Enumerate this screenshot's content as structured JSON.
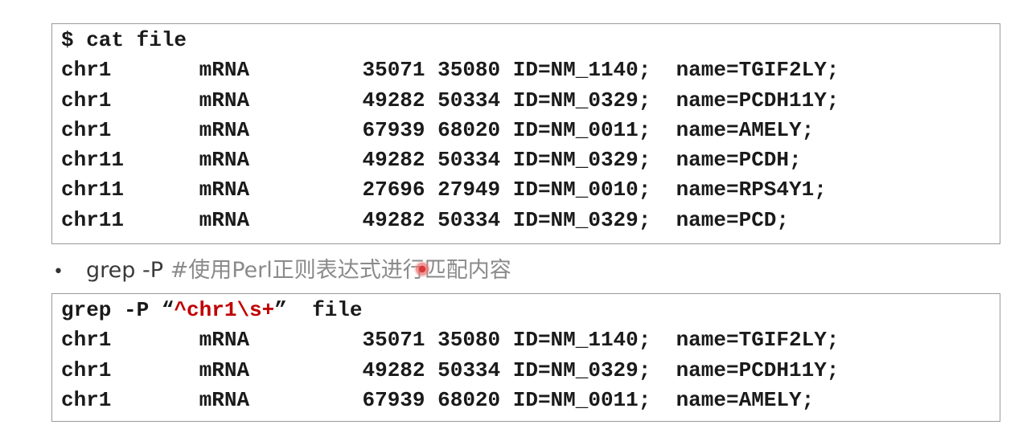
{
  "block1": {
    "prompt": "$ cat file",
    "rows": [
      {
        "chrom": "chr1",
        "type": "mRNA",
        "start": "35071",
        "end": "35080",
        "id": "ID=NM_1140;",
        "name": "name=TGIF2LY;"
      },
      {
        "chrom": "chr1",
        "type": "mRNA",
        "start": "49282",
        "end": "50334",
        "id": "ID=NM_0329;",
        "name": "name=PCDH11Y;"
      },
      {
        "chrom": "chr1",
        "type": "mRNA",
        "start": "67939",
        "end": "68020",
        "id": "ID=NM_0011;",
        "name": "name=AMELY;"
      },
      {
        "chrom": "chr11",
        "type": "mRNA",
        "start": "49282",
        "end": "50334",
        "id": "ID=NM_0329;",
        "name": "name=PCDH;"
      },
      {
        "chrom": "chr11",
        "type": "mRNA",
        "start": "27696",
        "end": "27949",
        "id": "ID=NM_0010;",
        "name": "name=RPS4Y1;"
      },
      {
        "chrom": "chr11",
        "type": "mRNA",
        "start": "49282",
        "end": "50334",
        "id": "ID=NM_0329;",
        "name": "name=PCD;"
      }
    ]
  },
  "bullet": {
    "marker": "•",
    "command": "grep -P ",
    "comment": "#使用Perl正则表达式进行匹配内容"
  },
  "block2": {
    "command": "grep -P ",
    "open_quote": "“",
    "pattern": "^chr1\\s+",
    "close_quote": "”",
    "file": "  file",
    "rows": [
      {
        "chrom": "chr1",
        "type": "mRNA",
        "start": "35071",
        "end": "35080",
        "id": "ID=NM_1140;",
        "name": "name=TGIF2LY;"
      },
      {
        "chrom": "chr1",
        "type": "mRNA",
        "start": "49282",
        "end": "50334",
        "id": "ID=NM_0329;",
        "name": "name=PCDH11Y;"
      },
      {
        "chrom": "chr1",
        "type": "mRNA",
        "start": "67939",
        "end": "68020",
        "id": "ID=NM_0011;",
        "name": "name=AMELY;"
      }
    ]
  },
  "colors": {
    "pattern": "#c00000",
    "text": "#1a1a1a",
    "comment": "#8a8a8a",
    "border": "#9a9a9a"
  }
}
